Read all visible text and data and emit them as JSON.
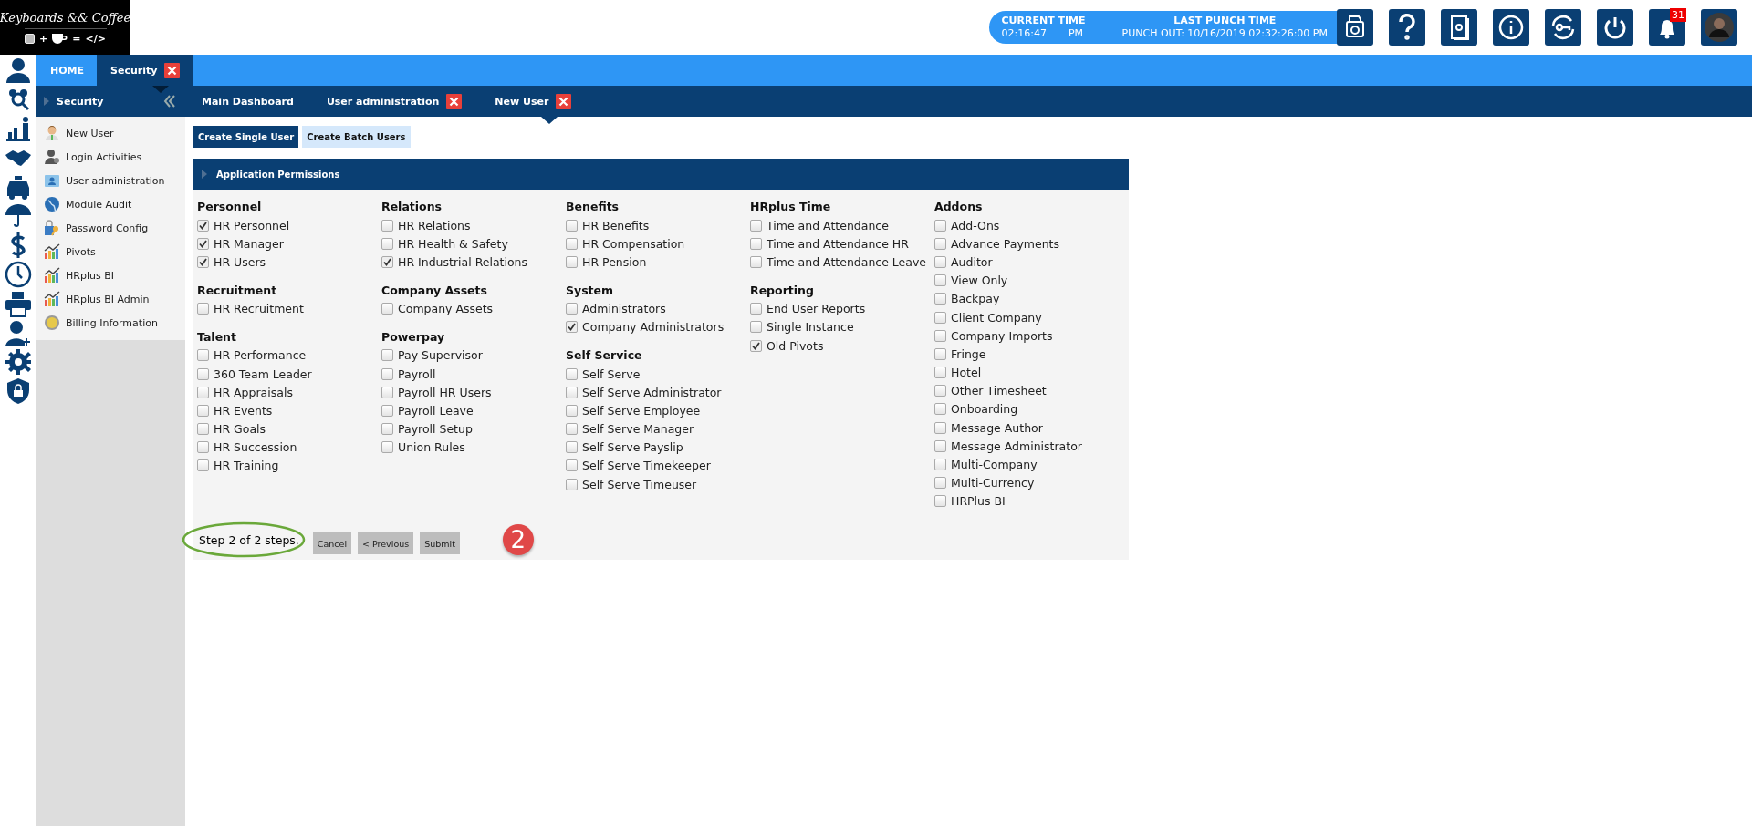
{
  "logo": {
    "title": "Keyboards && Coffee",
    "plus": "+",
    "equals": "=",
    "code": "</>"
  },
  "header": {
    "current_time_label": "CURRENT TIME",
    "current_time": "02:16:47",
    "am_pm": "PM",
    "last_punch_label": "LAST PUNCH TIME",
    "last_punch": "PUNCH OUT: 10/16/2019 02:32:26:00 PM",
    "notification_count": "31"
  },
  "tabs": [
    {
      "label": "HOME",
      "selected": false,
      "closable": false
    },
    {
      "label": "Security",
      "selected": true,
      "closable": true
    }
  ],
  "module_nav": {
    "title": "Security"
  },
  "sub_tabs": [
    {
      "label": "Main Dashboard",
      "selected": false,
      "closable": false
    },
    {
      "label": "User administration",
      "selected": false,
      "closable": true
    },
    {
      "label": "New User",
      "selected": true,
      "closable": true
    }
  ],
  "sidebar": {
    "items": [
      "New User",
      "Login Activities",
      "User administration",
      "Module Audit",
      "Password Config",
      "Pivots",
      "HRplus BI",
      "HRplus BI Admin",
      "Billing Information"
    ]
  },
  "mode_buttons": [
    {
      "label": "Create Single User",
      "selected": true
    },
    {
      "label": "Create Batch Users",
      "selected": false
    }
  ],
  "panel": {
    "title": "Application Permissions",
    "columns": [
      [
        {
          "heading": "Personnel",
          "items": [
            {
              "label": "HR Personnel",
              "checked": true
            },
            {
              "label": "HR Manager",
              "checked": true
            },
            {
              "label": "HR Users",
              "checked": true
            }
          ]
        },
        {
          "heading": "Recruitment",
          "items": [
            {
              "label": "HR Recruitment",
              "checked": false
            }
          ]
        },
        {
          "heading": "Talent",
          "items": [
            {
              "label": "HR Performance",
              "checked": false
            },
            {
              "label": "360 Team Leader",
              "checked": false
            },
            {
              "label": "HR Appraisals",
              "checked": false
            },
            {
              "label": "HR Events",
              "checked": false
            },
            {
              "label": "HR Goals",
              "checked": false
            },
            {
              "label": "HR Succession",
              "checked": false
            },
            {
              "label": "HR Training",
              "checked": false
            }
          ]
        }
      ],
      [
        {
          "heading": "Relations",
          "items": [
            {
              "label": "HR Relations",
              "checked": false
            },
            {
              "label": "HR Health & Safety",
              "checked": false
            },
            {
              "label": "HR Industrial Relations",
              "checked": true
            }
          ]
        },
        {
          "heading": "Company Assets",
          "items": [
            {
              "label": "Company Assets",
              "checked": false
            }
          ]
        },
        {
          "heading": "Powerpay",
          "items": [
            {
              "label": "Pay Supervisor",
              "checked": false
            },
            {
              "label": "Payroll",
              "checked": false
            },
            {
              "label": "Payroll HR Users",
              "checked": false
            },
            {
              "label": "Payroll Leave",
              "checked": false
            },
            {
              "label": "Payroll Setup",
              "checked": false
            },
            {
              "label": "Union Rules",
              "checked": false
            }
          ]
        }
      ],
      [
        {
          "heading": "Benefits",
          "items": [
            {
              "label": "HR Benefits",
              "checked": false
            },
            {
              "label": "HR Compensation",
              "checked": false
            },
            {
              "label": "HR Pension",
              "checked": false
            }
          ]
        },
        {
          "heading": "System",
          "items": [
            {
              "label": "Administrators",
              "checked": false
            },
            {
              "label": "Company Administrators",
              "checked": true
            }
          ]
        },
        {
          "heading": "Self Service",
          "items": [
            {
              "label": "Self Serve",
              "checked": false
            },
            {
              "label": "Self Serve Administrator",
              "checked": false
            },
            {
              "label": "Self Serve Employee",
              "checked": false
            },
            {
              "label": "Self Serve Manager",
              "checked": false
            },
            {
              "label": "Self Serve Payslip",
              "checked": false
            },
            {
              "label": "Self Serve Timekeeper",
              "checked": false
            },
            {
              "label": "Self Serve Timeuser",
              "checked": false
            }
          ]
        }
      ],
      [
        {
          "heading": "HRplus Time",
          "items": [
            {
              "label": "Time and Attendance",
              "checked": false
            },
            {
              "label": "Time and Attendance HR",
              "checked": false
            },
            {
              "label": "Time and Attendance Leave",
              "checked": false
            }
          ]
        },
        {
          "heading": "Reporting",
          "items": [
            {
              "label": "End User Reports",
              "checked": false
            },
            {
              "label": "Single Instance",
              "checked": false
            },
            {
              "label": "Old Pivots",
              "checked": true
            }
          ]
        }
      ],
      [
        {
          "heading": "Addons",
          "items": [
            {
              "label": "Add-Ons",
              "checked": false
            },
            {
              "label": "Advance Payments",
              "checked": false
            },
            {
              "label": "Auditor",
              "checked": false
            },
            {
              "label": "View Only",
              "checked": false
            },
            {
              "label": "Backpay",
              "checked": false
            },
            {
              "label": "Client Company",
              "checked": false
            },
            {
              "label": "Company Imports",
              "checked": false
            },
            {
              "label": "Fringe",
              "checked": false
            },
            {
              "label": "Hotel",
              "checked": false
            },
            {
              "label": "Other Timesheet",
              "checked": false
            },
            {
              "label": "Onboarding",
              "checked": false
            },
            {
              "label": "Message Author",
              "checked": false
            },
            {
              "label": "Message Administrator",
              "checked": false
            },
            {
              "label": "Multi-Company",
              "checked": false
            },
            {
              "label": "Multi-Currency",
              "checked": false
            },
            {
              "label": "HRPlus BI",
              "checked": false
            }
          ]
        }
      ]
    ]
  },
  "footer": {
    "step": "Step 2 of 2 steps.",
    "buttons": [
      "Cancel",
      "< Previous",
      "Submit"
    ],
    "annotation_number": "2"
  }
}
